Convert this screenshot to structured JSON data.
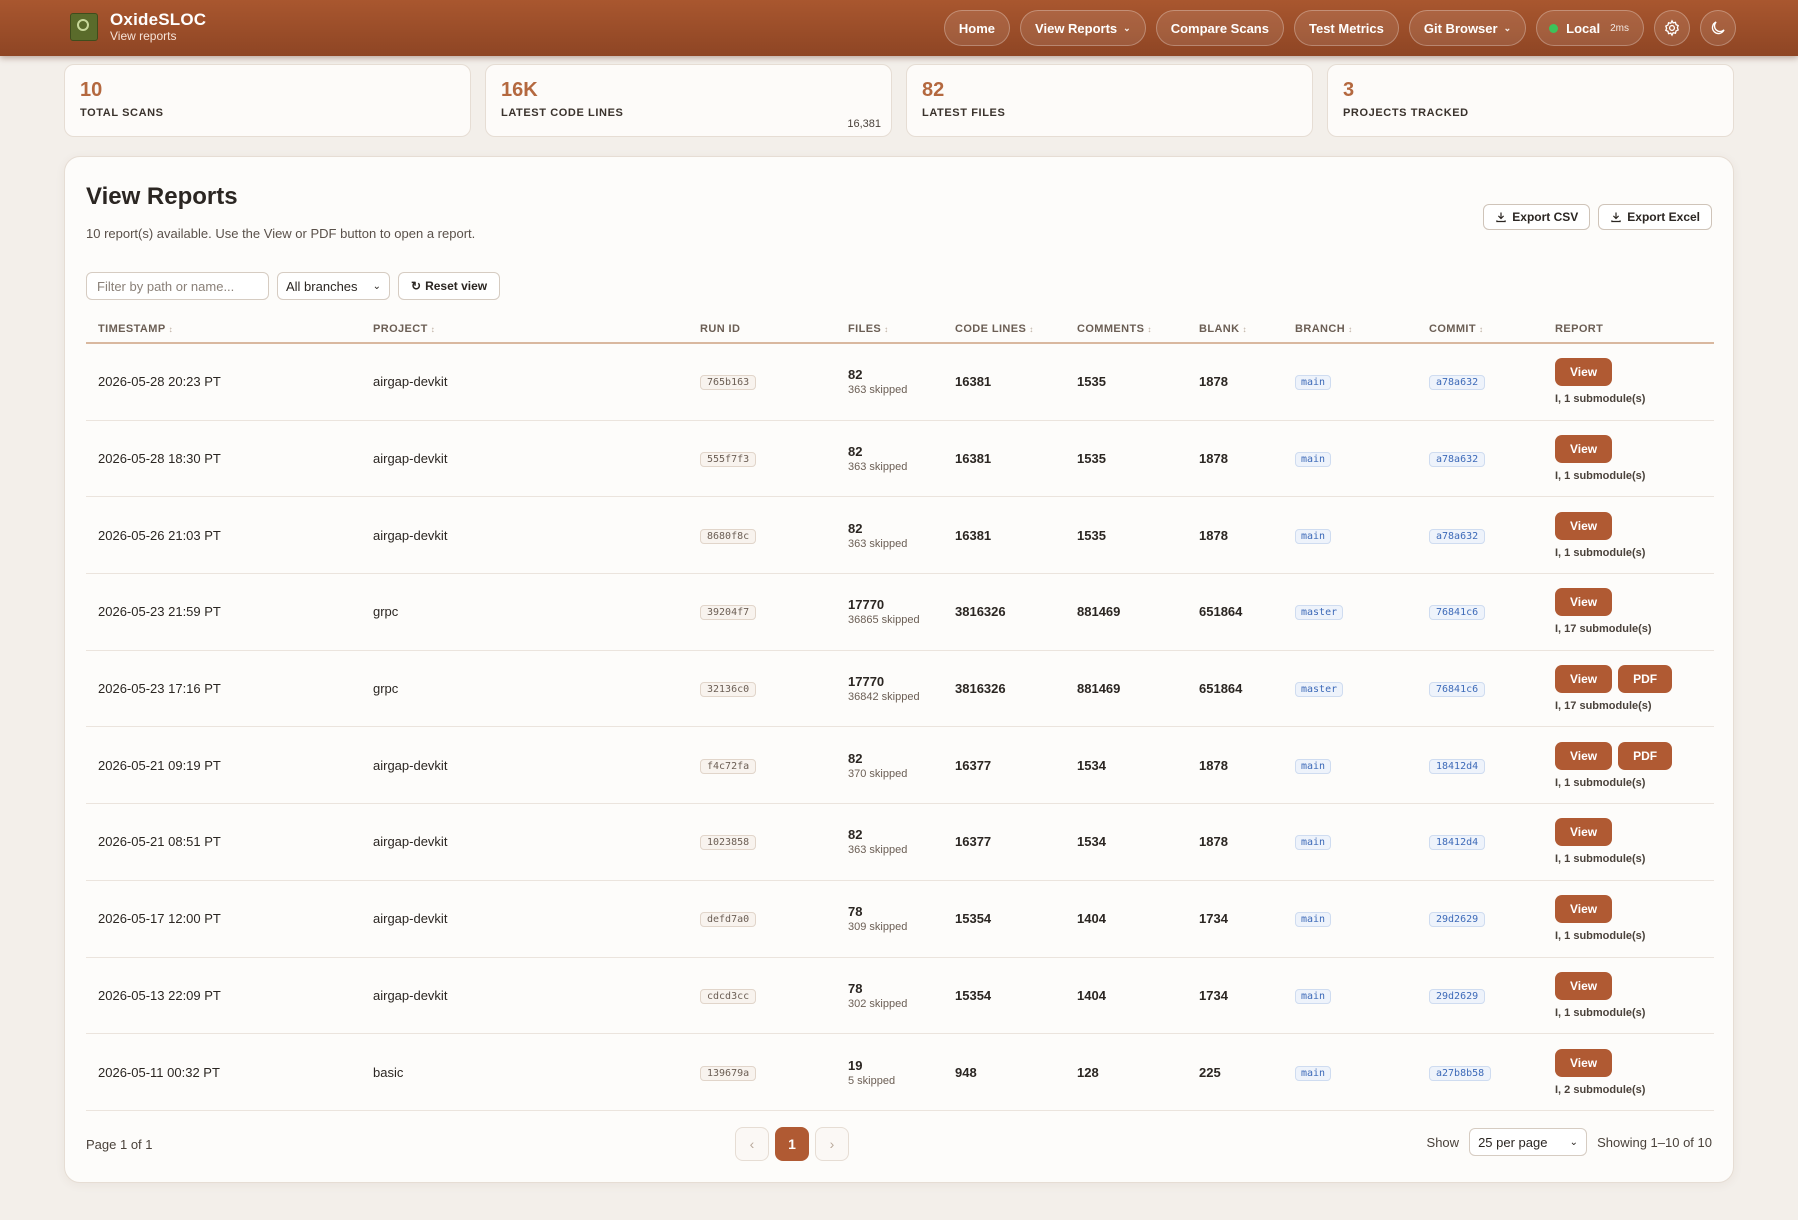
{
  "brand": {
    "name": "OxideSLOC",
    "subtitle": "View reports"
  },
  "nav": {
    "home": "Home",
    "view_reports": "View Reports",
    "compare_scans": "Compare Scans",
    "test_metrics": "Test Metrics",
    "git_browser": "Git Browser",
    "local": "Local",
    "latency": "2ms",
    "status_color": "#3cc35a"
  },
  "stats": [
    {
      "value": "10",
      "label": "TOTAL SCANS",
      "exact": ""
    },
    {
      "value": "16K",
      "label": "LATEST CODE LINES",
      "exact": "16,381"
    },
    {
      "value": "82",
      "label": "LATEST FILES",
      "exact": ""
    },
    {
      "value": "3",
      "label": "PROJECTS TRACKED",
      "exact": ""
    }
  ],
  "panel": {
    "title": "View Reports",
    "subtitle": "10 report(s) available. Use the View or PDF button to open a report.",
    "export_csv": "Export CSV",
    "export_excel": "Export Excel"
  },
  "filters": {
    "placeholder": "Filter by path or name...",
    "branch_selected": "All branches",
    "reset_label": "Reset view"
  },
  "table": {
    "headers": {
      "timestamp": "TIMESTAMP",
      "project": "PROJECT",
      "run_id": "RUN ID",
      "files": "FILES",
      "code_lines": "CODE LINES",
      "comments": "COMMENTS",
      "blank": "BLANK",
      "branch": "BRANCH",
      "commit": "COMMIT",
      "report": "REPORT"
    },
    "rows": [
      {
        "timestamp": "2026-05-28 20:23 PT",
        "project": "airgap-devkit",
        "run_id": "765b163",
        "files": "82",
        "skipped": "363 skipped",
        "code": "16381",
        "comments": "1535",
        "blank": "1878",
        "branch": "main",
        "commit": "a78a632",
        "has_pdf": false,
        "note": "I, 1 submodule(s)"
      },
      {
        "timestamp": "2026-05-28 18:30 PT",
        "project": "airgap-devkit",
        "run_id": "555f7f3",
        "files": "82",
        "skipped": "363 skipped",
        "code": "16381",
        "comments": "1535",
        "blank": "1878",
        "branch": "main",
        "commit": "a78a632",
        "has_pdf": false,
        "note": "I, 1 submodule(s)"
      },
      {
        "timestamp": "2026-05-26 21:03 PT",
        "project": "airgap-devkit",
        "run_id": "8680f8c",
        "files": "82",
        "skipped": "363 skipped",
        "code": "16381",
        "comments": "1535",
        "blank": "1878",
        "branch": "main",
        "commit": "a78a632",
        "has_pdf": false,
        "note": "I, 1 submodule(s)"
      },
      {
        "timestamp": "2026-05-23 21:59 PT",
        "project": "grpc",
        "run_id": "39204f7",
        "files": "17770",
        "skipped": "36865 skipped",
        "code": "3816326",
        "comments": "881469",
        "blank": "651864",
        "branch": "master",
        "commit": "76841c6",
        "has_pdf": false,
        "note": "I, 17 submodule(s)"
      },
      {
        "timestamp": "2026-05-23 17:16 PT",
        "project": "grpc",
        "run_id": "32136c0",
        "files": "17770",
        "skipped": "36842 skipped",
        "code": "3816326",
        "comments": "881469",
        "blank": "651864",
        "branch": "master",
        "commit": "76841c6",
        "has_pdf": true,
        "note": "I, 17 submodule(s)"
      },
      {
        "timestamp": "2026-05-21 09:19 PT",
        "project": "airgap-devkit",
        "run_id": "f4c72fa",
        "files": "82",
        "skipped": "370 skipped",
        "code": "16377",
        "comments": "1534",
        "blank": "1878",
        "branch": "main",
        "commit": "18412d4",
        "has_pdf": true,
        "note": "I, 1 submodule(s)"
      },
      {
        "timestamp": "2026-05-21 08:51 PT",
        "project": "airgap-devkit",
        "run_id": "1023858",
        "files": "82",
        "skipped": "363 skipped",
        "code": "16377",
        "comments": "1534",
        "blank": "1878",
        "branch": "main",
        "commit": "18412d4",
        "has_pdf": false,
        "note": "I, 1 submodule(s)"
      },
      {
        "timestamp": "2026-05-17 12:00 PT",
        "project": "airgap-devkit",
        "run_id": "defd7a0",
        "files": "78",
        "skipped": "309 skipped",
        "code": "15354",
        "comments": "1404",
        "blank": "1734",
        "branch": "main",
        "commit": "29d2629",
        "has_pdf": false,
        "note": "I, 1 submodule(s)"
      },
      {
        "timestamp": "2026-05-13 22:09 PT",
        "project": "airgap-devkit",
        "run_id": "cdcd3cc",
        "files": "78",
        "skipped": "302 skipped",
        "code": "15354",
        "comments": "1404",
        "blank": "1734",
        "branch": "main",
        "commit": "29d2629",
        "has_pdf": false,
        "note": "I, 1 submodule(s)"
      },
      {
        "timestamp": "2026-05-11 00:32 PT",
        "project": "basic",
        "run_id": "139679a",
        "files": "19",
        "skipped": "5 skipped",
        "code": "948",
        "comments": "128",
        "blank": "225",
        "branch": "main",
        "commit": "a27b8b58",
        "has_pdf": false,
        "note": "I, 2 submodule(s)"
      }
    ],
    "view_label": "View",
    "pdf_label": "PDF"
  },
  "footer": {
    "page_info": "Page 1 of 1",
    "prev": "‹",
    "current_page": "1",
    "next": "›",
    "show_label": "Show",
    "per_page": "25 per page",
    "showing": "Showing 1–10 of 10"
  },
  "colors": {
    "accent": "#b05a33",
    "header_bg": "#9a4d29",
    "stat_value": "#b4683f"
  }
}
